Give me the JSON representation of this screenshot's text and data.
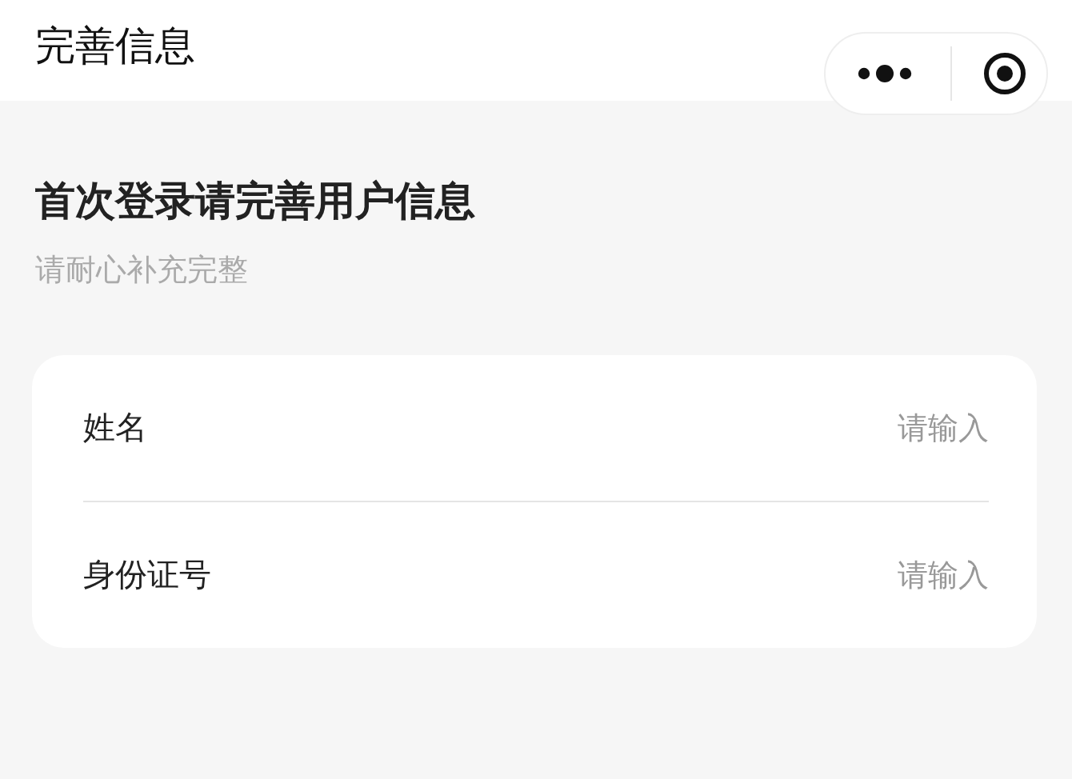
{
  "nav_bar": {
    "title": "完善信息"
  },
  "heading": "首次登录请完善用户信息",
  "subheading": "请耐心补充完整",
  "form": {
    "fields": [
      {
        "label": "姓名",
        "placeholder": "请输入"
      },
      {
        "label": "身份证号",
        "placeholder": "请输入"
      }
    ]
  }
}
